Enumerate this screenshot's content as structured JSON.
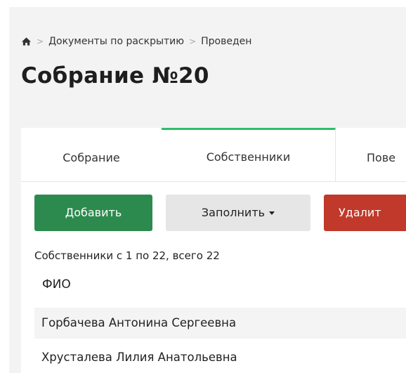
{
  "breadcrumb": {
    "items": [
      "Документы по раскрытию",
      "Проведен"
    ]
  },
  "page": {
    "title": "Собрание №20"
  },
  "tabs": [
    {
      "label": "Собрание",
      "active": false
    },
    {
      "label": "Собственники",
      "active": true
    },
    {
      "label": "Пове",
      "active": false
    }
  ],
  "toolbar": {
    "add_label": "Добавить",
    "fill_label": "Заполнить",
    "delete_label": "Удалит"
  },
  "table": {
    "summary": "Собственники с 1 по 22, всего 22",
    "columns": [
      "ФИО"
    ],
    "rows": [
      {
        "name": "Горбачева Антонина Сергеевна"
      },
      {
        "name": "Хрусталева Лилия Анатольевна"
      }
    ]
  },
  "colors": {
    "active_tab_accent": "#2ebd6b",
    "add_button": "#2d8a4e",
    "delete_button": "#c0392b",
    "fill_button": "#e6e6e6"
  }
}
